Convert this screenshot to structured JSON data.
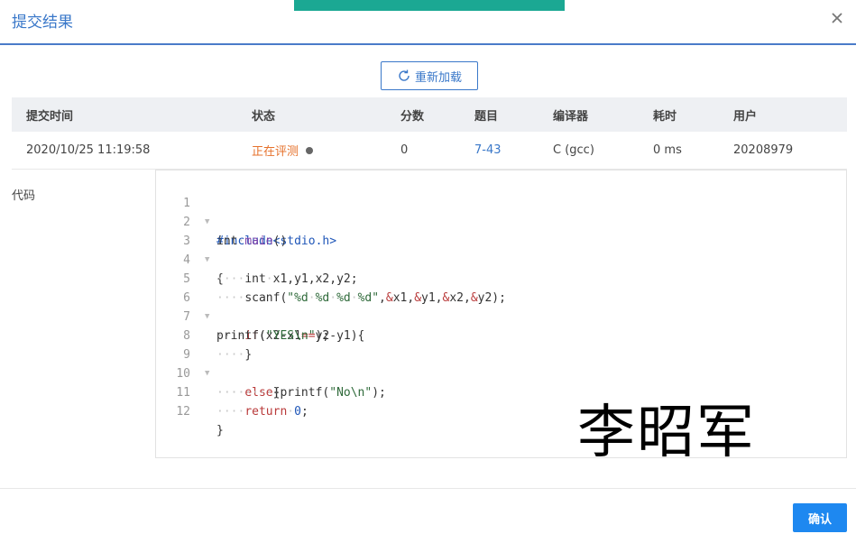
{
  "dialog": {
    "title": "提交结果"
  },
  "reload_label": "重新加载",
  "table": {
    "headers": {
      "time": "提交时间",
      "status": "状态",
      "score": "分数",
      "problem": "题目",
      "compiler": "编译器",
      "elapsed": "耗时",
      "user": "用户"
    },
    "row": {
      "time": "2020/10/25 11:19:58",
      "status": "正在评测",
      "score": "0",
      "problem": "7-43",
      "compiler": "C (gcc)",
      "elapsed": "0 ms",
      "user": "20208979"
    }
  },
  "code_label": "代码",
  "code": {
    "line_numbers": [
      "1",
      "2",
      "3",
      "4",
      "5",
      "6",
      "7",
      "8",
      "9",
      "10",
      "11",
      "12"
    ],
    "l1": {
      "pp": "#include<stdio.h>"
    },
    "l2": {
      "t1": "int",
      "ws": "·",
      "fn": "main",
      "t2": "()"
    },
    "l3": {
      "t1": "{"
    },
    "l4": {
      "ws": "····",
      "t1": "int",
      "ws2": "·",
      "t2": "x1,y1,x2,y2;"
    },
    "l5": {
      "ws": "····",
      "t1": "scanf(",
      "s1": "\"%d",
      "ws2": "·",
      "s2": "%d",
      "ws3": "·",
      "s3": "%d",
      "ws4": "·",
      "s4": "%d\"",
      "t2": ",",
      "k1": "&",
      "t3": "x1,",
      "k2": "&",
      "t4": "y1,",
      "k3": "&",
      "t5": "x2,",
      "k4": "&",
      "t6": "y2);"
    },
    "l6": {
      "ws": "····",
      "kw": "if",
      "t1": "(x2-x1",
      "op": "==",
      "t2": "y2-y1){"
    },
    "l7": {
      "t1": "printf(",
      "s1": "\"YES\\n\"",
      "t2": ");"
    },
    "l8": {
      "ws": "····",
      "t1": "}"
    },
    "l9": {
      "ws": "····",
      "kw": "else",
      "t1": "{printf(",
      "s1": "\"No\\n\"",
      "t2": ");"
    },
    "l10": {
      "ws": "········",
      "t1": "}"
    },
    "l11": {
      "ws": "····",
      "kw": "return",
      "ws2": "·",
      "num": "0",
      "t1": ";"
    },
    "l12": {
      "t1": "}"
    }
  },
  "watermark": "李昭军",
  "confirm_label": "确认",
  "colors": {
    "accent": "#3a78c9",
    "running": "#e6712b",
    "primary_button": "#1e88f0",
    "top_strip": "#1ba893"
  }
}
